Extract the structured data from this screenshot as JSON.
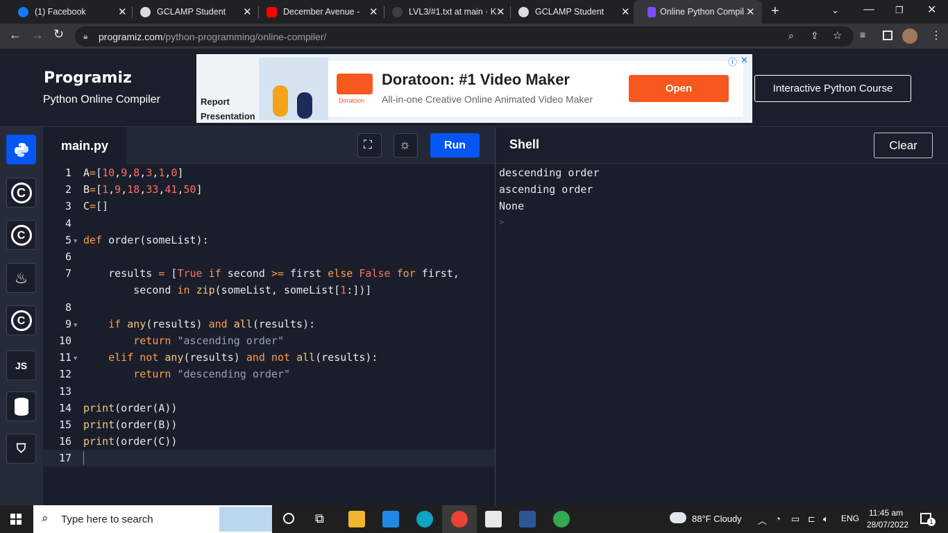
{
  "browser": {
    "tabs": [
      {
        "label": "(1) Facebook",
        "icon": "facebook-icon"
      },
      {
        "label": "GCLAMP Student",
        "icon": "globe-icon"
      },
      {
        "label": "December Avenue - E",
        "icon": "youtube-icon"
      },
      {
        "label": "LVL3/#1.txt at main · K",
        "icon": "github-icon"
      },
      {
        "label": "GCLAMP Student",
        "icon": "globe-icon"
      },
      {
        "label": "Online Python Compil",
        "icon": "programiz-icon"
      }
    ],
    "url_domain": "programiz.com",
    "url_path": "/python-programming/online-compiler/"
  },
  "header": {
    "logo": "Programiz",
    "subtitle": "Python Online Compiler",
    "course_button": "Interactive Python Course"
  },
  "ad": {
    "left_text": "Report Presentation",
    "brand": "Doratoon",
    "title": "Doratoon: #1 Video Maker",
    "desc": "All-in-one Creative Online Animated Video Maker",
    "cta": "Open"
  },
  "sidebar": {
    "languages": [
      "python",
      "c",
      "cpp",
      "java",
      "csharp",
      "JS",
      "sql",
      "html"
    ]
  },
  "editor": {
    "filename": "main.py",
    "run_label": "Run",
    "line_numbers": [
      "1",
      "2",
      "3",
      "4",
      "5",
      "6",
      "7",
      "",
      "8",
      "9",
      "10",
      "11",
      "12",
      "13",
      "14",
      "15",
      "16",
      "17"
    ]
  },
  "shell": {
    "title": "Shell",
    "clear_label": "Clear",
    "output": [
      "descending order",
      "ascending order",
      "None"
    ],
    "prompt": ">"
  },
  "taskbar": {
    "search_placeholder": "Type here to search",
    "weather": "88°F  Cloudy",
    "lang": "ENG",
    "time": "11:45 am",
    "date": "28/07/2022",
    "notifications": "1"
  },
  "colors": {
    "accent": "#0556f3",
    "ad_cta": "#f7581d",
    "code_keyword": "#ff9d4d",
    "code_number": "#ff6e63"
  }
}
